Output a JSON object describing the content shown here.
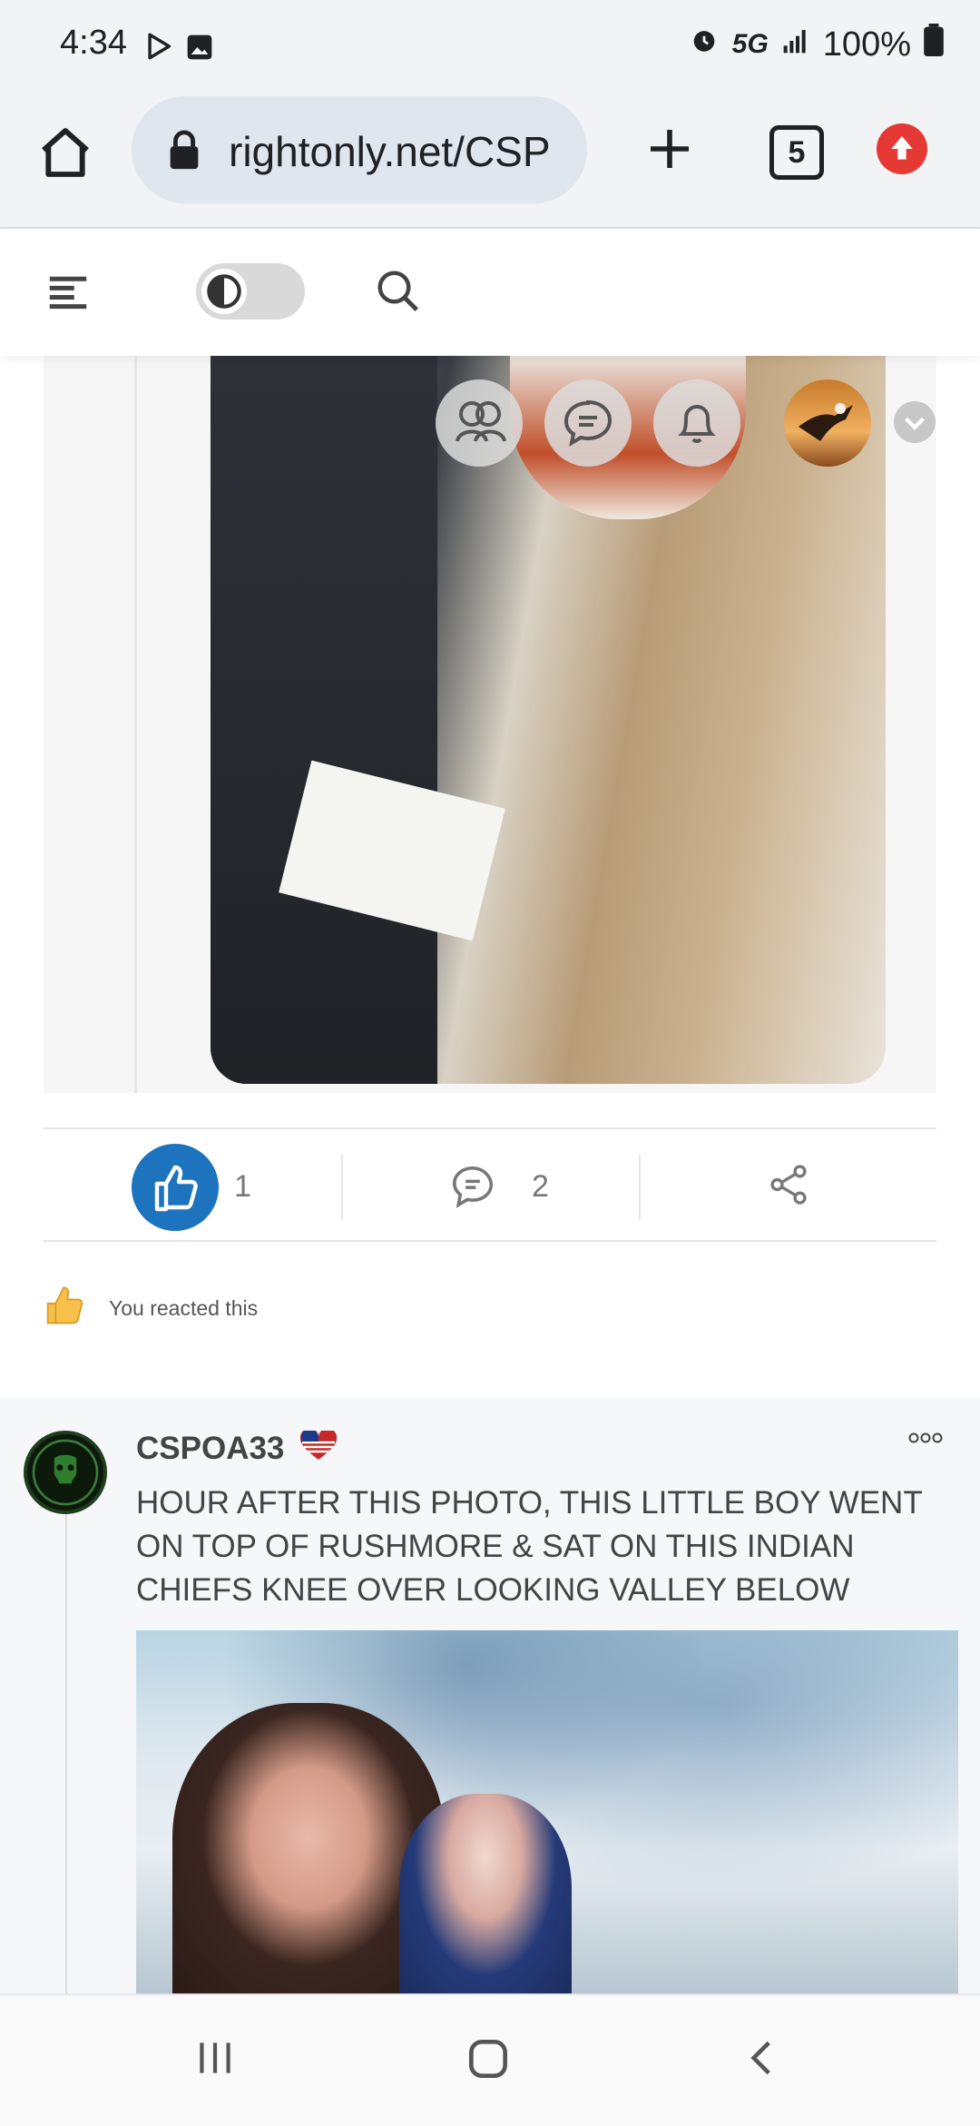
{
  "status_bar": {
    "time": "4:34",
    "network": "5G",
    "battery": "100%"
  },
  "browser": {
    "url": "rightonly.net/CSP",
    "tab_count": "5"
  },
  "post1": {
    "like_count": "1",
    "comment_count": "2",
    "reacted_label": "You reacted this"
  },
  "post2": {
    "author": "CSPOA33",
    "text": "HOUR AFTER THIS PHOTO, THIS LITTLE BOY WENT ON TOP OF RUSHMORE & SAT ON THIS INDIAN CHIEFS KNEE OVER LOOKING VALLEY BELOW"
  },
  "colors": {
    "accent": "#1e73be",
    "upload_badge": "#e53935"
  }
}
